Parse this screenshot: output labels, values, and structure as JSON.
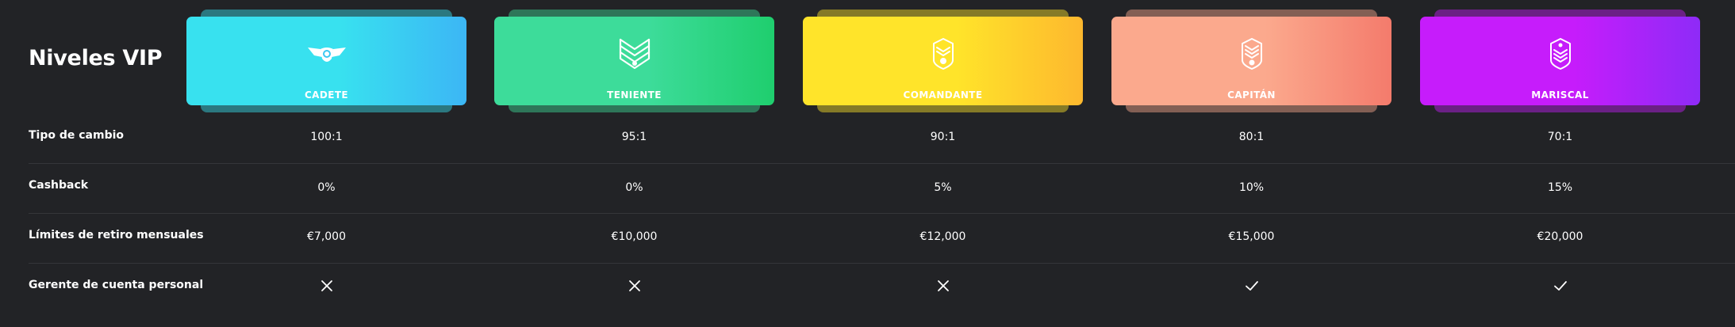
{
  "title": "Niveles VIP",
  "tiers": [
    {
      "name": "CADETE",
      "colors": [
        "#38E1EF",
        "#3CB6F5"
      ],
      "icon": "wings-badge-icon"
    },
    {
      "name": "TENIENTE",
      "colors": [
        "#3DDC9A",
        "#1FCE6E"
      ],
      "icon": "chevron-stripes-icon"
    },
    {
      "name": "COMANDANTE",
      "colors": [
        "#FFE42A",
        "#FDB82E"
      ],
      "icon": "shield-rank-icon"
    },
    {
      "name": "CAPITÁN",
      "colors": [
        "#FBA98D",
        "#F47B6C"
      ],
      "icon": "shield-rank-icon"
    },
    {
      "name": "MARISCAL",
      "colors": [
        "#C61CFB",
        "#8E2BF7"
      ],
      "icon": "shield-rank-icon"
    }
  ],
  "rows": [
    {
      "label": "Tipo de cambio",
      "values": [
        "100:1",
        "95:1",
        "90:1",
        "80:1",
        "70:1"
      ]
    },
    {
      "label": "Cashback",
      "values": [
        "0%",
        "0%",
        "5%",
        "10%",
        "15%"
      ]
    },
    {
      "label": "Límites de retiro mensuales",
      "values": [
        "€7,000",
        "€10,000",
        "€12,000",
        "€15,000",
        "€20,000"
      ]
    },
    {
      "label": "Gerente de cuenta personal",
      "marks": [
        "cross",
        "cross",
        "cross",
        "check",
        "check"
      ]
    }
  ]
}
